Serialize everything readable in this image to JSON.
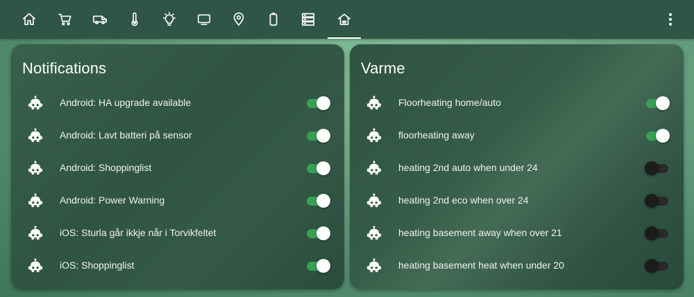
{
  "tabs": [
    {
      "icon": "home-icon",
      "label": ""
    },
    {
      "icon": "cart-icon",
      "label": ""
    },
    {
      "icon": "van-icon",
      "label": ""
    },
    {
      "icon": "thermometer-icon",
      "label": ""
    },
    {
      "icon": "lightbulb-icon",
      "label": ""
    },
    {
      "icon": "monitor-icon",
      "label": ""
    },
    {
      "icon": "map-marker-icon",
      "label": ""
    },
    {
      "icon": "battery-icon",
      "label": ""
    },
    {
      "icon": "server-icon",
      "label": ""
    },
    {
      "icon": "home-automation-icon",
      "label": "",
      "active": true
    }
  ],
  "notifications": {
    "title": "Notifications",
    "items": [
      {
        "label": "Android: HA upgrade available",
        "on": true
      },
      {
        "label": "Android: Lavt batteri på sensor",
        "on": true
      },
      {
        "label": "Android: Shoppinglist",
        "on": true
      },
      {
        "label": "Android: Power Warning",
        "on": true
      },
      {
        "label": "iOS: Sturla går ikkje når i Torvikfeltet",
        "on": true
      },
      {
        "label": "iOS: Shoppinglist",
        "on": true
      }
    ]
  },
  "varme": {
    "title": "Varme",
    "items": [
      {
        "label": "Floorheating home/auto",
        "on": true
      },
      {
        "label": "floorheating away",
        "on": true
      },
      {
        "label": "heating 2nd auto when under 24",
        "on": false
      },
      {
        "label": "heating 2nd eco when over 24",
        "on": false
      },
      {
        "label": "heating basement away when over 21",
        "on": false
      },
      {
        "label": "heating basement heat when under 20",
        "on": false
      }
    ]
  },
  "colors": {
    "toggle_on": "#37a054",
    "toggle_off": "#2a2a2a",
    "header": "#2f5546"
  }
}
